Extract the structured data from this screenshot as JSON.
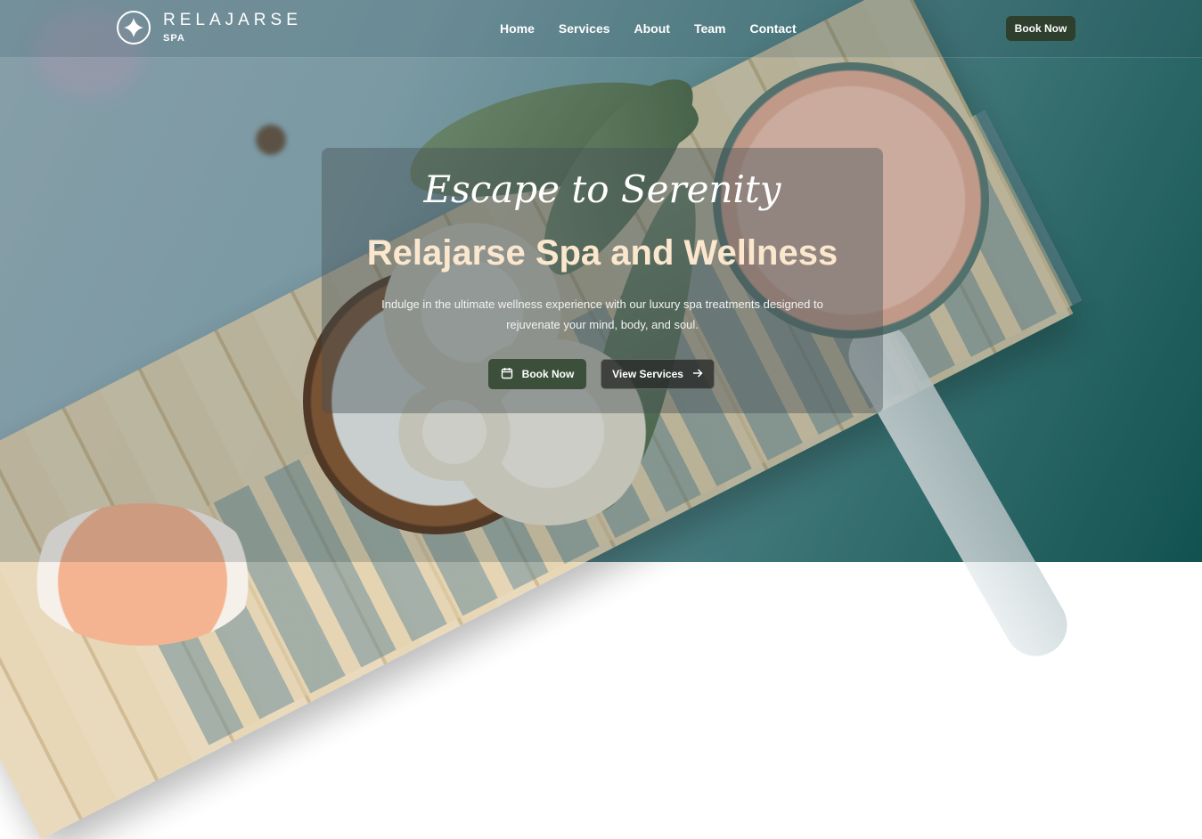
{
  "brand": {
    "name": "RELAJARSE",
    "sub": "SPA"
  },
  "nav": {
    "links": [
      {
        "label": "Home"
      },
      {
        "label": "Services"
      },
      {
        "label": "About"
      },
      {
        "label": "Team"
      },
      {
        "label": "Contact"
      }
    ],
    "book_label": "Book Now"
  },
  "hero": {
    "tagline": "Escape to Serenity",
    "title": "Relajarse Spa and Wellness",
    "description": "Indulge in the ultimate wellness experience with our luxury spa treatments designed to rejuvenate your mind, body, and soul.",
    "primary_button": "Book Now",
    "secondary_button": "View Services"
  },
  "colors": {
    "title_cream": "#fbe7cd",
    "button_green": "#3b4f3a",
    "nav_book_bg": "#2f3f2e"
  },
  "icons": {
    "logo": "flower-logo-icon",
    "primary_button": "calendar-icon",
    "secondary_button": "arrow-right-icon"
  }
}
